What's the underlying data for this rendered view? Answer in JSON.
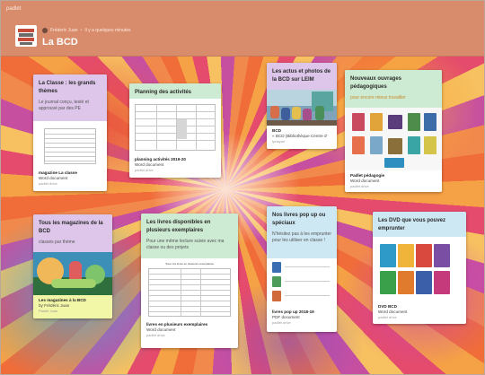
{
  "app": {
    "name": "padlet"
  },
  "header": {
    "author": "Fréderic Juan",
    "separator": "•",
    "updated": "Il y a quelques minutes",
    "title": "La BCD"
  },
  "cards": [
    {
      "title": "La Classe : les grands thèmes",
      "description": "Le journal conçu, testé et approuvé par des PE",
      "file_name": "magazine La classe",
      "file_type": "Word document",
      "source": "padlet drive"
    },
    {
      "title": "Planning des activités",
      "file_name": "planning activités 2019-20",
      "file_type": "Word document",
      "source": "padlet drive"
    },
    {
      "title": "Les actus et photos de la BCD sur LEIM",
      "file_name": "BCD",
      "file_type": "« BCD (Bibliothèque Centre d'",
      "source": "Ipnayne"
    },
    {
      "title": "Nouveaux ouvrages pédagogiques",
      "description": "pour encore mieux travailler",
      "file_name": "Padlet pédagogie",
      "file_type": "Word document",
      "source": "padlet drive"
    },
    {
      "title": "Tous les magazines de la BCD",
      "description": "classés par thème",
      "file_name": "Les magazines à la BCD",
      "file_type": "by Frédéric Juan",
      "source": "Padlet Juan"
    },
    {
      "title": "Les livres disponibles en plusieurs exemplaires",
      "description": "Pour une même lecture suivie avec ma classe ou des projets",
      "thumb_text": "Tous nos livres en plusieurs exemplaires",
      "file_name": "livres en plusieurs exemplaires",
      "file_type": "Word document",
      "source": "padlet drive"
    },
    {
      "title": "Nos livres pop up ou spéciaux",
      "description": "N'hésitez pas à les emprunter pour les utiliser en classe !",
      "file_name": "livres pop up 2018-19",
      "file_type": "PDF document",
      "source": "padlet drive"
    },
    {
      "title": "Les DVD que vous pouvez emprunter",
      "file_name": "DVD BCD",
      "file_type": "Word document",
      "source": "padlet drive"
    }
  ],
  "colors": {
    "header": "#d88c6c",
    "lilac": "#ddc6ea",
    "green": "#cdebd2",
    "blue": "#cde8f3"
  }
}
